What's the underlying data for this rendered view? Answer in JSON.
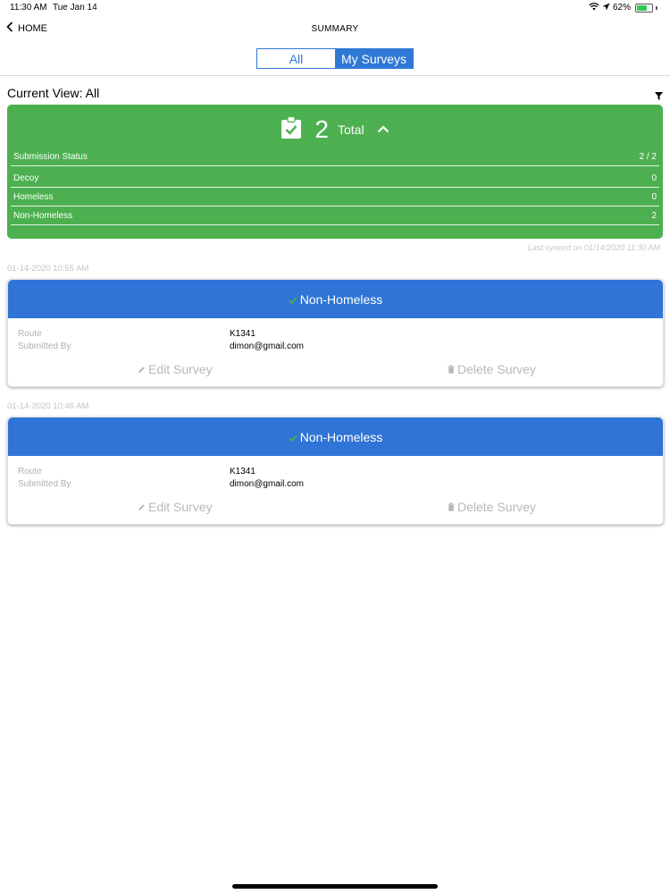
{
  "status_bar": {
    "time": "11:30 AM",
    "date": "Tue Jan 14",
    "battery": "62%",
    "battery_level": 0.62
  },
  "nav": {
    "back_label": "HOME",
    "title": "SUMMARY"
  },
  "segments": {
    "all": "All",
    "my_surveys": "My Surveys",
    "selected": "My Surveys"
  },
  "current_view": "Current View: All",
  "summary": {
    "total_count": "2",
    "total_label": "Total",
    "rows": [
      {
        "label": "Submission Status",
        "value": "2 / 2"
      },
      {
        "label": "Decoy",
        "value": "0"
      },
      {
        "label": "Homeless",
        "value": "0"
      },
      {
        "label": "Non-Homeless",
        "value": "2"
      }
    ]
  },
  "last_synced": "Last synced on 01/14/2020 11:30 AM",
  "surveys": [
    {
      "timestamp": "01-14-2020 10:55 AM",
      "status": "Non-Homeless",
      "route_label": "Route",
      "route_value": "K1341",
      "submitted_by_label": "Submitted By",
      "submitted_by_value": "dimon@gmail.com",
      "edit_label": "Edit Survey",
      "delete_label": "Delete Survey"
    },
    {
      "timestamp": "01-14-2020 10:46 AM",
      "status": "Non-Homeless",
      "route_label": "Route",
      "route_value": "K1341",
      "submitted_by_label": "Submitted By",
      "submitted_by_value": "dimon@gmail.com",
      "edit_label": "Edit Survey",
      "delete_label": "Delete Survey"
    }
  ],
  "colors": {
    "accent_blue": "#2f74d6",
    "summary_green": "#4db050",
    "battery_green": "#34c759"
  },
  "icons": [
    "wifi-icon",
    "location-arrow-icon",
    "battery-icon",
    "chevron-left-icon",
    "filter-icon",
    "clipboard-check-icon",
    "chevron-up-icon",
    "check-icon",
    "pencil-icon",
    "trash-icon"
  ]
}
